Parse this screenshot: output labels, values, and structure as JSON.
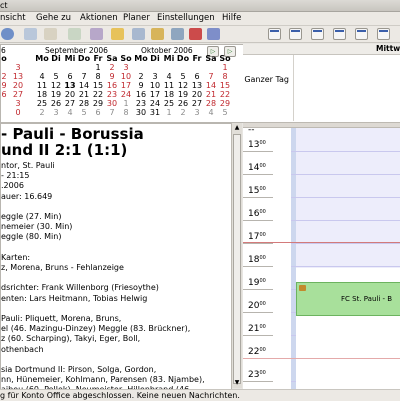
{
  "window": {
    "title_fragment": "ct"
  },
  "menu": [
    "nsicht",
    "Gehe zu",
    "Aktionen",
    "Planer",
    "Einstellungen",
    "Hilfe"
  ],
  "calendars": {
    "sept": {
      "title": "September 2006",
      "weekdays": [
        "Mo",
        "Di",
        "Mi",
        "Do",
        "Fr",
        "Sa",
        "So"
      ],
      "rows": [
        [
          "",
          "",
          "",
          "",
          "1",
          "2",
          "3"
        ],
        [
          "4",
          "5",
          "6",
          "7",
          "8",
          "9",
          "10"
        ],
        [
          "11",
          "12",
          "13",
          "14",
          "15",
          "16",
          "17"
        ],
        [
          "18",
          "19",
          "20",
          "21",
          "22",
          "23",
          "24"
        ],
        [
          "25",
          "26",
          "27",
          "28",
          "29",
          "30",
          "1"
        ],
        [
          "2",
          "3",
          "4",
          "5",
          "6",
          "7",
          "8"
        ]
      ]
    },
    "okt": {
      "title": "Oktober 2006",
      "weekdays": [
        "Mo",
        "Di",
        "Mi",
        "Do",
        "Fr",
        "Sa",
        "So"
      ],
      "rows": [
        [
          "",
          "",
          "",
          "",
          "",
          "",
          "1"
        ],
        [
          "2",
          "3",
          "4",
          "5",
          "6",
          "7",
          "8"
        ],
        [
          "9",
          "10",
          "11",
          "12",
          "13",
          "14",
          "15"
        ],
        [
          "16",
          "17",
          "18",
          "19",
          "20",
          "21",
          "22"
        ],
        [
          "23",
          "24",
          "25",
          "26",
          "27",
          "28",
          "29"
        ],
        [
          "30",
          "31",
          "1",
          "2",
          "3",
          "4",
          "5"
        ]
      ]
    },
    "aug_partial": {
      "title": "6",
      "weekday_fragment": "o",
      "rows": [
        [
          "3"
        ],
        [
          "2",
          "13"
        ],
        [
          "9",
          "20"
        ],
        [
          "6",
          "27"
        ],
        [
          "3"
        ],
        [
          "0"
        ]
      ]
    }
  },
  "dayview": {
    "day_label": "Mittw",
    "allday_label": "Ganzer Tag",
    "hours": [
      "13",
      "14",
      "15",
      "16",
      "17",
      "18",
      "19",
      "20",
      "21",
      "22",
      "23"
    ],
    "minutes_label": "00",
    "top_dashes": "--",
    "event_title": "FC St. Pauli - B"
  },
  "details": {
    "title_line1": "- Pauli - Borussia",
    "title_line2": "und II 2:1 (1:1)",
    "lines": [
      "ntor, St. Pauli",
      "- 21:15",
      ".2006",
      "auer: 16.649",
      "",
      "eggle (27. Min)",
      "nemeier (30. Min)",
      "eggle (80. Min)",
      "",
      "Karten:",
      "z, Morena, Bruns - Fehlanzeige",
      "",
      "dsrichter: Frank Willenborg (Friesoythe)",
      "enten: Lars Heitmann, Tobias Helwig",
      "",
      "Pauli: Pliquett, Morena, Bruns,",
      "el (46. Mazingu-Dinzey) Meggle (83. Brückner),",
      "z (60. Scharping), Takyi, Eger, Boll,",
      "othenbach",
      "",
      "sia Dortmund II: Pirson, Solga, Gordon,",
      "nn, Hünemeier, Kohlmann, Parensen (83. Njambe),",
      "aibou (60. Pollok), Neumeister, Hillenbrand (46."
    ]
  },
  "status": "g für Konto Office abgeschlossen. Keine neuen Nachrichten."
}
